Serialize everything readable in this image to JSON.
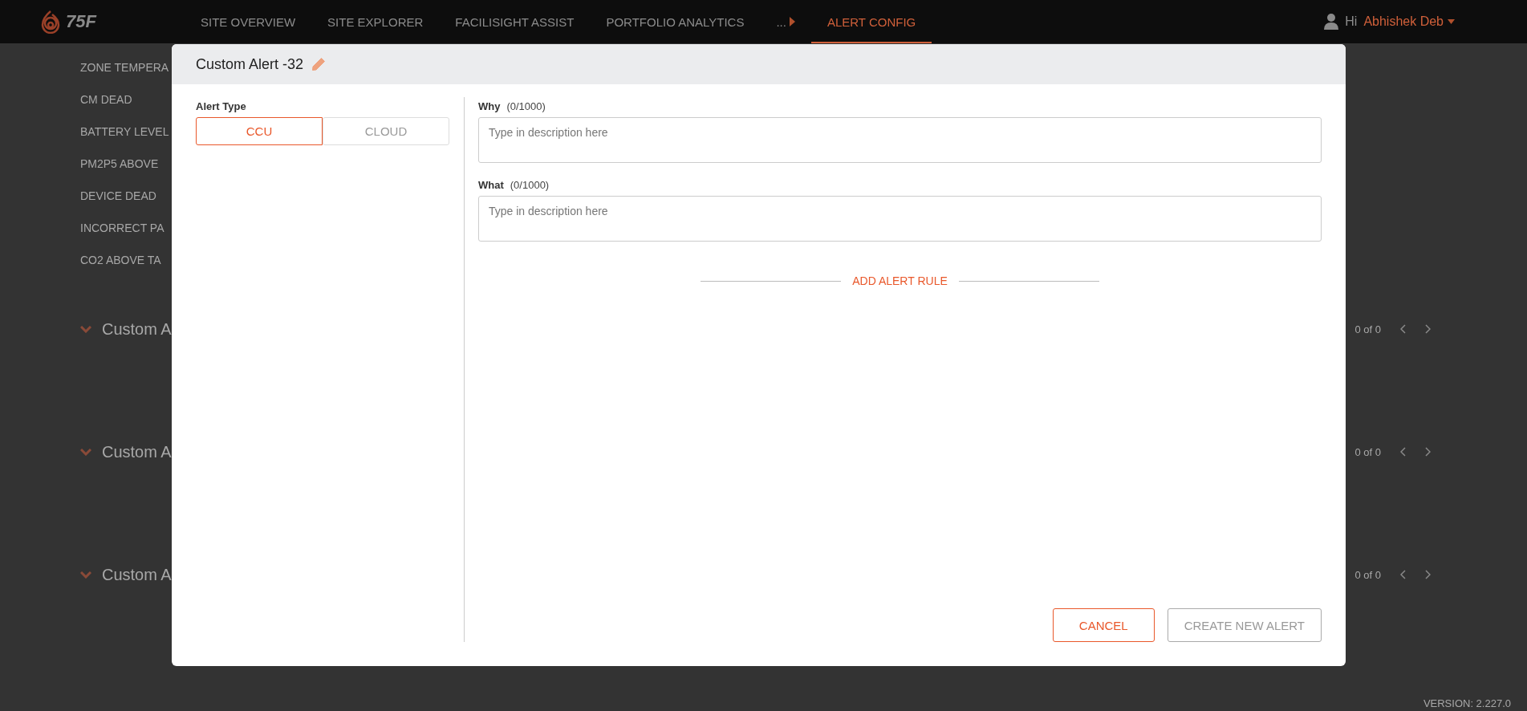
{
  "nav": {
    "logo": "75F",
    "items": [
      {
        "kind": "link",
        "label": "SITE OVERVIEW",
        "selected": false
      },
      {
        "kind": "link",
        "label": "SITE EXPLORER",
        "selected": false
      },
      {
        "kind": "link",
        "label": "FACILISIGHT ASSIST",
        "selected": false
      },
      {
        "kind": "link",
        "label": "PORTFOLIO ANALYTICS",
        "selected": false
      },
      {
        "kind": "overflow",
        "label": "...",
        "selected": false
      },
      {
        "kind": "link",
        "label": "ALERT CONFIG",
        "selected": true
      }
    ],
    "greeting": "Hi",
    "user_name": "Abhishek Deb"
  },
  "background": {
    "alerts": [
      "ZONE TEMPERA",
      "CM DEAD",
      "BATTERY LEVEL",
      "PM2P5 ABOVE",
      "DEVICE DEAD",
      "INCORRECT PA",
      "CO2 ABOVE TA"
    ],
    "sections": [
      {
        "title": "Custom A",
        "pager": "0 of 0"
      },
      {
        "title": "Custom A",
        "pager": "0 of 0"
      },
      {
        "title": "Custom A",
        "pager": "0 of 0"
      }
    ],
    "version": "VERSION: 2.227.0"
  },
  "modal": {
    "title": "Custom Alert -32",
    "alert_type_label": "Alert Type",
    "alert_types": [
      {
        "label": "CCU",
        "selected": true
      },
      {
        "label": "CLOUD",
        "selected": false
      }
    ],
    "fields": [
      {
        "label": "Why",
        "counter": "(0/1000)",
        "placeholder": "Type in description here"
      },
      {
        "label": "What",
        "counter": "(0/1000)",
        "placeholder": "Type in description here"
      }
    ],
    "add_rule": "ADD ALERT RULE",
    "buttons": [
      {
        "label": "CANCEL",
        "disabled": false
      },
      {
        "label": "CREATE NEW ALERT",
        "disabled": true
      }
    ]
  }
}
